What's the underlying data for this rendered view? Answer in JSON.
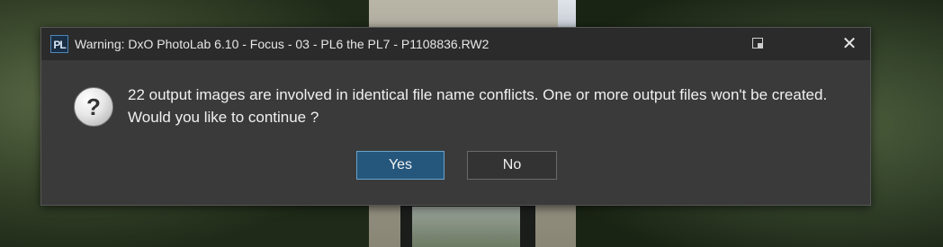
{
  "dialog": {
    "title": "Warning: DxO PhotoLab 6.10 - Focus - 03 - PL6 the PL7 - P1108836.RW2",
    "app_icon_text": "PL",
    "close_glyph": "✕",
    "question_glyph": "?",
    "message": "22 output images are involved in identical file name conflicts. One or more output files won't be created. Would you like to continue ?",
    "buttons": {
      "yes": "Yes",
      "no": "No"
    }
  },
  "icons": [
    "app-logo-icon",
    "window-mode-icon",
    "close-icon",
    "question-icon"
  ],
  "colors": {
    "dialog_bg": "#3a3a3a",
    "titlebar_bg": "#2b2b2b",
    "primary_button": "#25577d"
  }
}
